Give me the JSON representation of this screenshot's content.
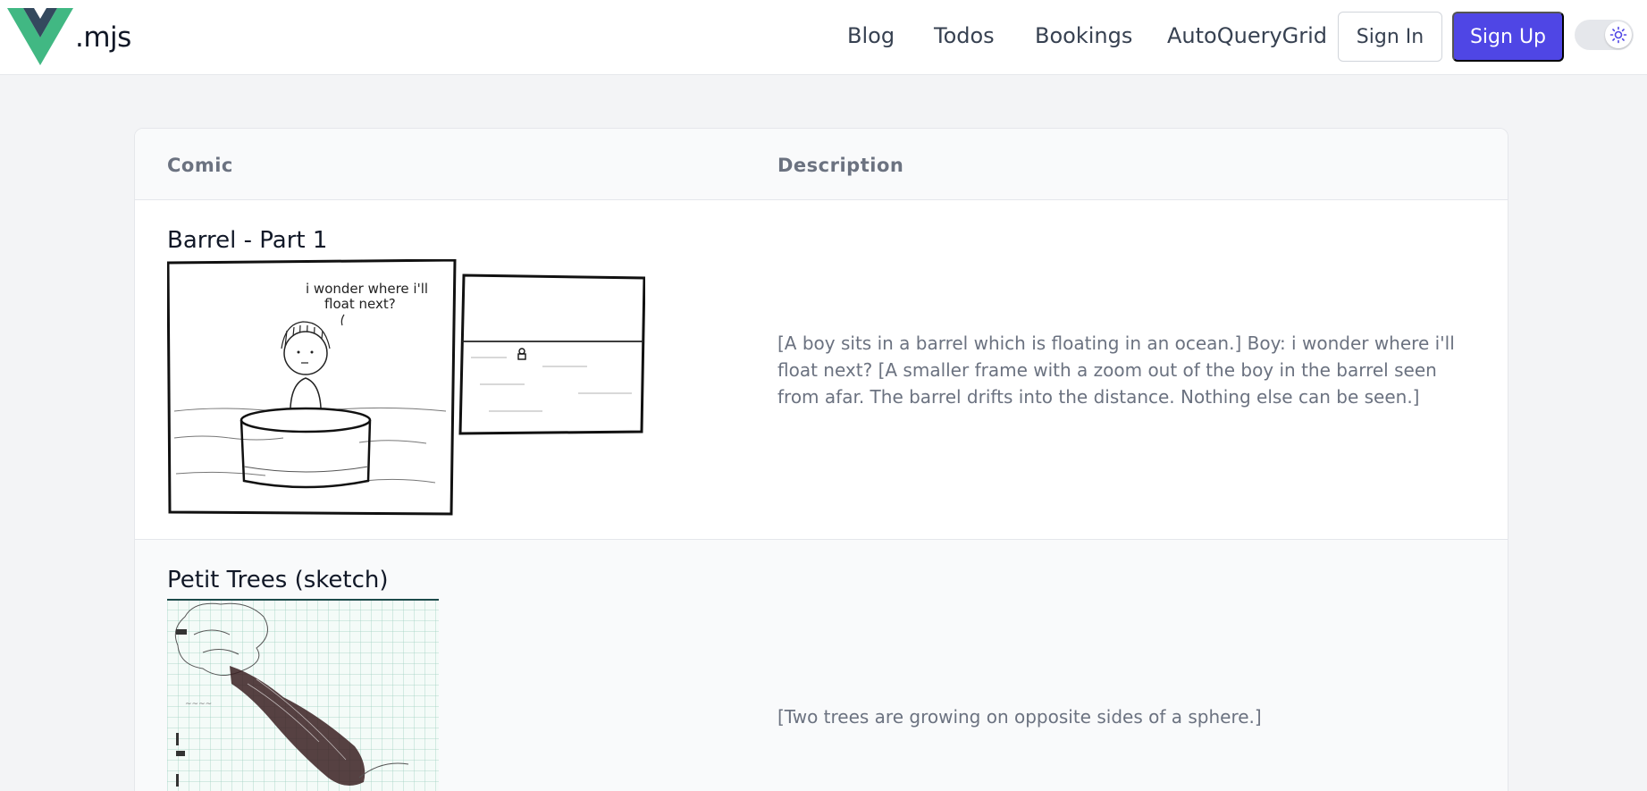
{
  "header": {
    "logo_text": ".mjs",
    "nav": [
      {
        "label": "Blog"
      },
      {
        "label": "Todos"
      },
      {
        "label": "Bookings"
      },
      {
        "label": "AutoQueryGrid"
      }
    ],
    "sign_in": "Sign In",
    "sign_up": "Sign Up",
    "brand_color": "#4f46e5",
    "logo_colors": [
      "#41b883",
      "#34495e"
    ]
  },
  "table": {
    "columns": [
      "Comic",
      "Description"
    ],
    "rows": [
      {
        "title": "Barrel - Part 1",
        "speech": [
          "i wonder where i'll",
          "float next?"
        ],
        "description": "[A boy sits in a barrel which is floating in an ocean.] Boy: i wonder where i'll float next? [A smaller frame with a zoom out of the boy in the barrel seen from afar. The barrel drifts into the distance. Nothing else can be seen.]"
      },
      {
        "title": "Petit Trees (sketch)",
        "description": "[Two trees are growing on opposite sides of a sphere.]"
      }
    ]
  }
}
